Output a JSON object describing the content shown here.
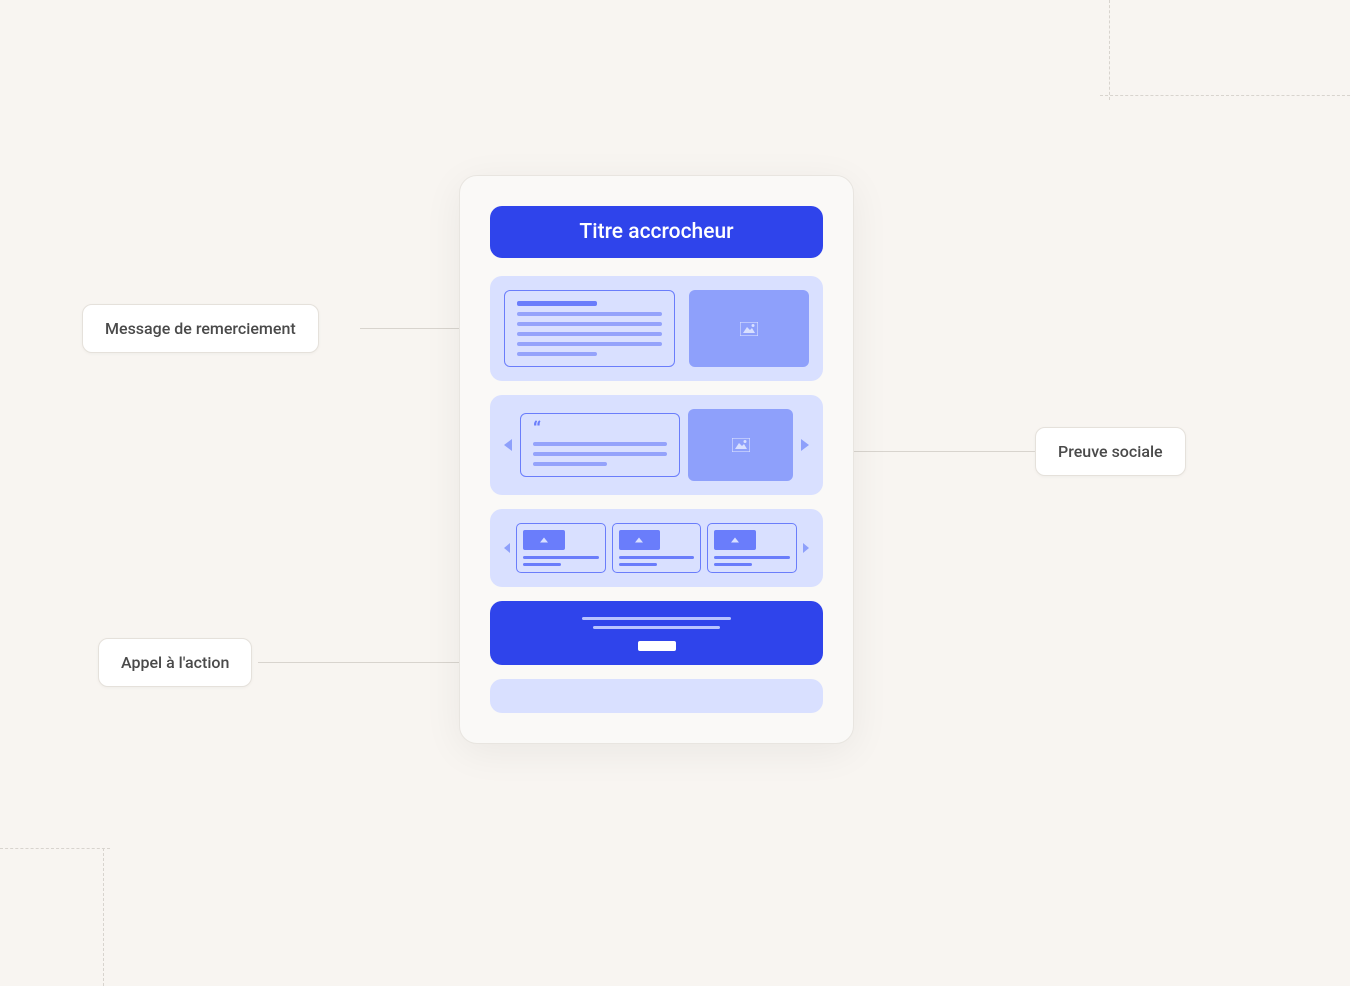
{
  "header": {
    "title": "Titre accrocheur"
  },
  "callouts": {
    "thank_you": "Message de remerciement",
    "social_proof": "Preuve sociale",
    "cta": "Appel à l'action"
  }
}
